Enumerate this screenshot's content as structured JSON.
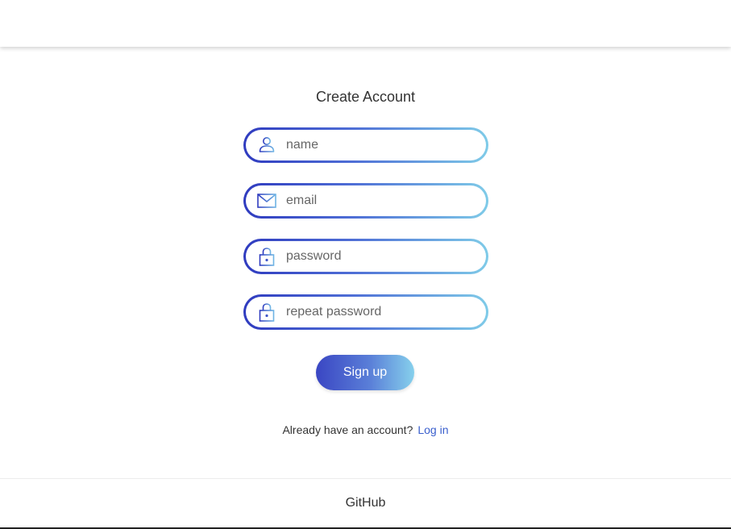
{
  "form": {
    "title": "Create Account",
    "fields": [
      {
        "name": "name",
        "placeholder": "name",
        "icon": "user-icon"
      },
      {
        "name": "email",
        "placeholder": "email",
        "icon": "envelope-icon"
      },
      {
        "name": "password",
        "placeholder": "password",
        "icon": "lock-icon"
      },
      {
        "name": "repeat_password",
        "placeholder": "repeat password",
        "icon": "lock-icon"
      }
    ],
    "submit_label": "Sign up",
    "login_prompt": "Already have an account?",
    "login_link": "Log in"
  },
  "footer": {
    "link": "GitHub"
  },
  "colors": {
    "gradient_start": "#2f3bbf",
    "gradient_end": "#7fcbe8",
    "link": "#3a5fcd"
  }
}
